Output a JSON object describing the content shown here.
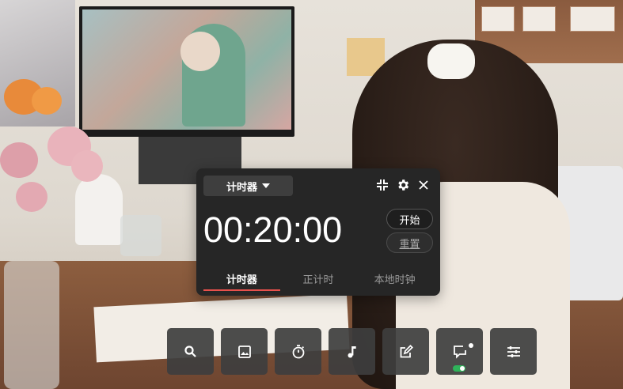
{
  "timer": {
    "mode_label": "计时器",
    "time": "00:20:00",
    "start_label": "开始",
    "reset_label": "重置",
    "tabs": [
      {
        "label": "计时器",
        "active": true
      },
      {
        "label": "正计时",
        "active": false
      },
      {
        "label": "本地时钟",
        "active": false
      }
    ],
    "header_icons": [
      "shrink-icon",
      "gear-icon",
      "close-icon"
    ],
    "accent_color": "#e8514c"
  },
  "toolbar": {
    "buttons": [
      {
        "icon": "search-icon"
      },
      {
        "icon": "image-icon"
      },
      {
        "icon": "stopwatch-icon"
      },
      {
        "icon": "music-note-icon"
      },
      {
        "icon": "edit-icon"
      },
      {
        "icon": "chat-bubble-icon",
        "toggle_on": true
      },
      {
        "icon": "sliders-icon"
      }
    ],
    "toggle_color": "#2fb35a"
  }
}
